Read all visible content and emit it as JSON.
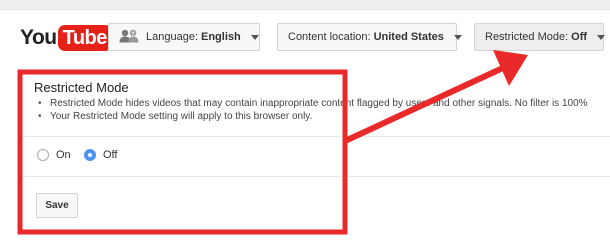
{
  "header": {
    "logo_you": "You",
    "logo_tube": "Tube",
    "language_label": "Language:",
    "language_value": "English",
    "location_label": "Content location:",
    "location_value": "United States",
    "restricted_label": "Restricted Mode:",
    "restricted_value": "Off"
  },
  "panel": {
    "title": "Restricted Mode",
    "bullets": [
      "Restricted Mode hides videos that may contain inappropriate content flagged by users and other signals. No filter is 100%",
      "Your Restricted Mode setting will apply to this browser only."
    ],
    "options": [
      {
        "label": "On",
        "checked": false
      },
      {
        "label": "Off",
        "checked": true
      }
    ],
    "save_label": "Save"
  },
  "colors": {
    "annotation_red": "#ea2a2a",
    "brand_red": "#e62117",
    "radio_blue": "#4e92f2"
  },
  "icons": {
    "language": "people-icon",
    "dropdown": "caret-down-icon"
  }
}
